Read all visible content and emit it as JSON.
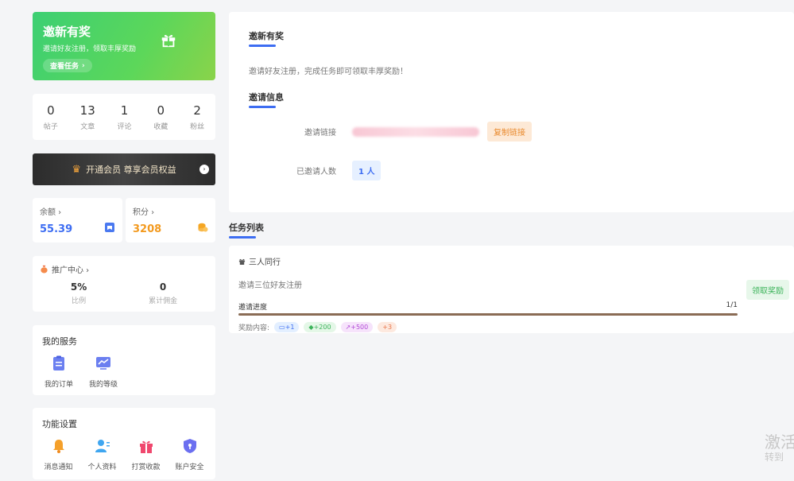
{
  "promo": {
    "title": "邀新有奖",
    "subtitle": "邀请好友注册，领取丰厚奖励",
    "button": "查看任务",
    "button_arrow": "›"
  },
  "stats": [
    {
      "value": "0",
      "label": "帖子"
    },
    {
      "value": "13",
      "label": "文章"
    },
    {
      "value": "1",
      "label": "评论"
    },
    {
      "value": "0",
      "label": "收藏"
    },
    {
      "value": "2",
      "label": "粉丝"
    }
  ],
  "vip": {
    "label": "开通会员 尊享会员权益",
    "crown": "♛",
    "arrow": "›"
  },
  "wallet": {
    "balance_label": "余额 ›",
    "balance_value": "55.39",
    "balance_color": "#3d6df2",
    "points_label": "积分 ›",
    "points_value": "3208",
    "points_color": "#f39a1f"
  },
  "promo_center": {
    "title": "推广中心 ›",
    "ratio_value": "5%",
    "ratio_label": "比例",
    "commission_value": "0",
    "commission_label": "累计佣金"
  },
  "services": {
    "title": "我的服务",
    "items": [
      {
        "label": "我的订单",
        "icon": "order-icon"
      },
      {
        "label": "我的等级",
        "icon": "level-icon"
      }
    ]
  },
  "settings": {
    "title": "功能设置",
    "items": [
      {
        "label": "消息通知",
        "icon": "bell-icon"
      },
      {
        "label": "个人资料",
        "icon": "profile-icon"
      },
      {
        "label": "打赏收款",
        "icon": "gift-box-icon"
      },
      {
        "label": "账户安全",
        "icon": "shield-icon"
      }
    ]
  },
  "invite": {
    "title": "邀新有奖",
    "description": "邀请好友注册，完成任务即可领取丰厚奖励！",
    "info_title": "邀请信息",
    "link_label": "邀请链接",
    "copy_button": "复制链接",
    "count_label": "已邀请人数",
    "count_value": "1 人"
  },
  "tasks": {
    "title": "任务列表",
    "items": [
      {
        "name": "三人同行",
        "description": "邀请三位好友注册",
        "progress_label": "邀请进度",
        "progress_text": "1/1",
        "progress": 1.0,
        "rewards_label": "奖励内容:",
        "rewards": [
          {
            "text": "+1",
            "icon": "ticket-icon",
            "bg": "#e3efff",
            "color": "#3d6df2"
          },
          {
            "text": "+200",
            "icon": "diamond-icon",
            "bg": "#e4f7e7",
            "color": "#3cb35a"
          },
          {
            "text": "+500",
            "icon": "chart-icon",
            "bg": "#f6e3fb",
            "color": "#b149d6"
          },
          {
            "text": "+3",
            "icon": "",
            "bg": "#fde9df",
            "color": "#e8764a"
          }
        ],
        "claim_button": "领取奖励"
      }
    ]
  },
  "activation": {
    "line1": "激活",
    "line2": "转到"
  }
}
